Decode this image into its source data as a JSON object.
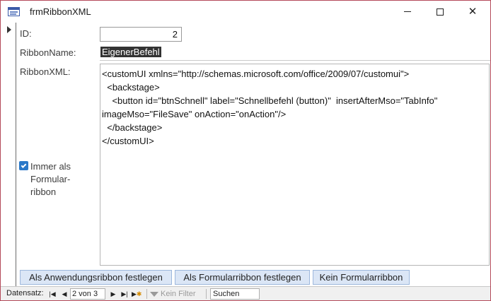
{
  "window": {
    "title": "frmRibbonXML",
    "close_glyph": "✕"
  },
  "form": {
    "id_label": "ID:",
    "id_value": "2",
    "ribbon_name_label": "RibbonName:",
    "ribbon_name_value": "EigenerBefehl",
    "ribbon_xml_label": "RibbonXML:",
    "ribbon_xml_lines": [
      "<customUI xmlns=\"http://schemas.microsoft.com/office/2009/07/customui\">",
      "  <backstage>",
      "    <button id=\"btnSchnell\" label=\"Schnellbefehl (button)\"  insertAfterMso=\"TabInfo\"",
      "imageMso=\"FileSave\" onAction=\"onAction\"/>",
      "  </backstage>",
      "</customUI>"
    ],
    "checkbox_checked": true,
    "checkbox_label": "Immer als Formular-ribbon"
  },
  "buttons": {
    "set_app_ribbon": "Als Anwendungsribbon festlegen",
    "set_form_ribbon": "Als Formularribbon festlegen",
    "no_form_ribbon": "Kein Formularribbon"
  },
  "navigation": {
    "record_label": "Datensatz:",
    "current_record": "2 von 3",
    "filter_label": "Kein Filter",
    "search_placeholder": "Suchen",
    "first_glyph": "|◀",
    "prev_glyph": "◀",
    "next_glyph": "▶",
    "last_glyph": "▶|",
    "new_glyph": "▶"
  },
  "colors": {
    "window_border": "#b44a5a",
    "button_bg": "#dbe6f6",
    "checkbox": "#2a78c8"
  }
}
